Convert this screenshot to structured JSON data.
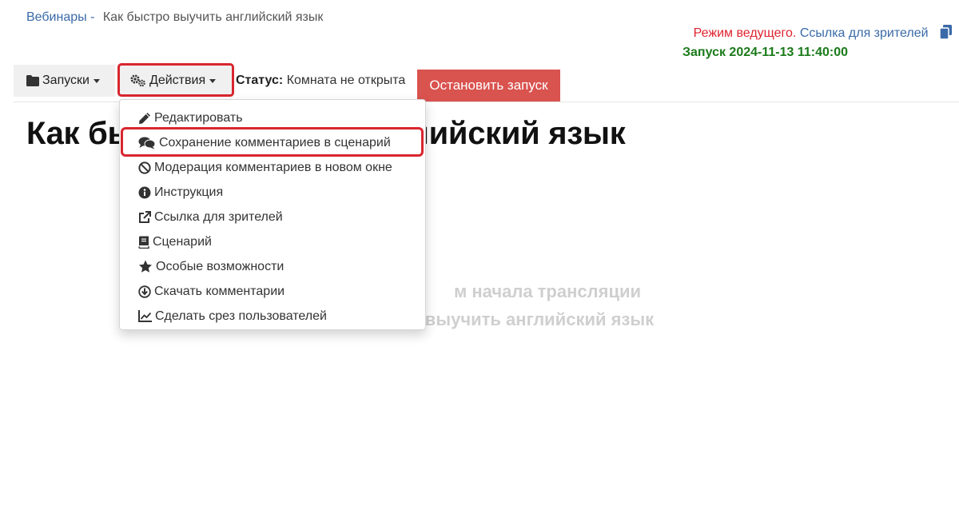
{
  "breadcrumb": {
    "root": "Вебинары",
    "separator": "-",
    "current": "Как быстро выучить английский язык"
  },
  "header_right": {
    "mode": "Режим ведущего.",
    "viewer_link": "Ссылка для зрителей",
    "launch_info": "Запуск 2024-11-13 11:40:00"
  },
  "toolbar": {
    "launches_label": "Запуски",
    "actions_label": "Действия",
    "status_label": "Статус:",
    "status_value": "Комната не открыта",
    "stop_label": "Остановить запуск"
  },
  "page_title": "Как быстро выучить английский язык",
  "placeholder": {
    "line1": "м начала трансляции",
    "line2": "выучить английский язык"
  },
  "dropdown": {
    "items": [
      {
        "icon": "pencil-icon",
        "label": "Редактировать"
      },
      {
        "icon": "comments-icon",
        "label": "Сохранение комментариев в сценарий"
      },
      {
        "icon": "ban-icon",
        "label": "Модерация комментариев в новом окне"
      },
      {
        "icon": "info-icon",
        "label": "Инструкция"
      },
      {
        "icon": "external-link-icon",
        "label": "Ссылка для зрителей"
      },
      {
        "icon": "book-icon",
        "label": "Сценарий"
      },
      {
        "icon": "star-icon",
        "label": "Особые возможности"
      },
      {
        "icon": "download-icon",
        "label": "Скачать комментарии"
      },
      {
        "icon": "chart-line-icon",
        "label": "Сделать срез пользователей"
      }
    ]
  },
  "colors": {
    "link": "#3a6aa8",
    "mode_red": "#e0232f",
    "launch_green": "#1a7a1a",
    "stop_button": "#d9534f",
    "highlight": "#d8262f"
  }
}
